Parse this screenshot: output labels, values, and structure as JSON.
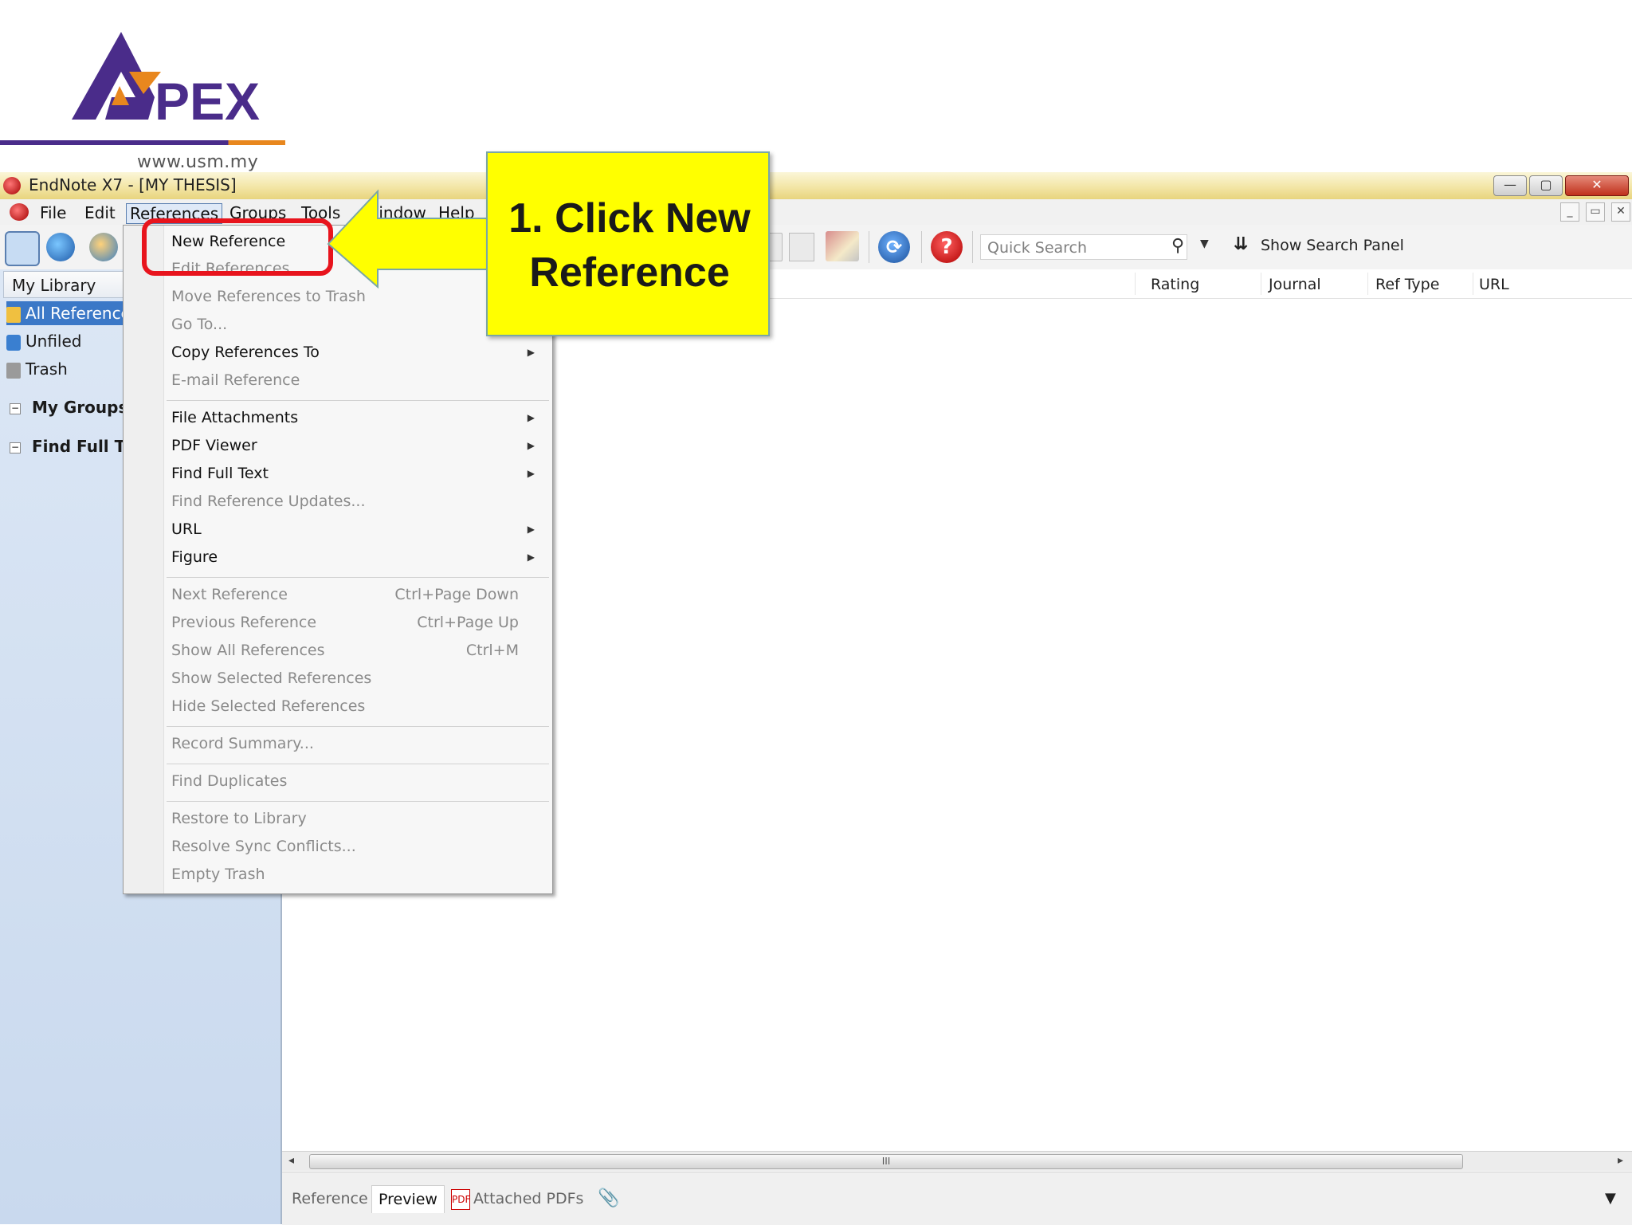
{
  "logo": {
    "brand": "APEX",
    "url": "www.usm.my"
  },
  "window": {
    "title": "EndNote X7 - [MY THESIS]",
    "buttons": {
      "minimize": "—",
      "maximize": "▢",
      "close": "✕"
    }
  },
  "menubar": {
    "items": [
      "File",
      "Edit",
      "References",
      "Groups",
      "Tools",
      "Window",
      "Help"
    ],
    "mdi_buttons": [
      "_",
      "▭",
      "✕"
    ]
  },
  "toolbar": {
    "quick_search_placeholder": "Quick Search",
    "show_search_panel": "Show Search Panel"
  },
  "left_panel": {
    "header": "My Library",
    "items": [
      "All References",
      "Unfiled",
      "Trash"
    ],
    "groups": [
      "My Groups",
      "Find Full Text"
    ]
  },
  "columns": [
    "Rating",
    "Journal",
    "Ref Type",
    "URL"
  ],
  "references_menu": {
    "items": [
      {
        "label": "New Reference",
        "enabled": true,
        "shortcut": ""
      },
      {
        "label": "Edit References",
        "enabled": false,
        "shortcut": ""
      },
      {
        "label": "Move References to Trash",
        "enabled": false,
        "shortcut": ""
      },
      {
        "label": "Go To...",
        "enabled": false,
        "shortcut": ""
      },
      {
        "label": "Copy References To",
        "enabled": true,
        "submenu": true
      },
      {
        "label": "E-mail Reference",
        "enabled": false
      },
      {
        "label": "File Attachments",
        "enabled": true,
        "submenu": true
      },
      {
        "label": "PDF Viewer",
        "enabled": true,
        "submenu": true
      },
      {
        "label": "Find Full Text",
        "enabled": true,
        "submenu": true
      },
      {
        "label": "Find Reference Updates...",
        "enabled": false
      },
      {
        "label": "URL",
        "enabled": true,
        "submenu": true
      },
      {
        "label": "Figure",
        "enabled": true,
        "submenu": true
      },
      {
        "label": "Next Reference",
        "enabled": false,
        "shortcut": "Ctrl+Page Down"
      },
      {
        "label": "Previous Reference",
        "enabled": false,
        "shortcut": "Ctrl+Page Up"
      },
      {
        "label": "Show All References",
        "enabled": false,
        "shortcut": "Ctrl+M"
      },
      {
        "label": "Show Selected References",
        "enabled": false
      },
      {
        "label": "Hide Selected References",
        "enabled": false
      },
      {
        "label": "Record Summary...",
        "enabled": false
      },
      {
        "label": "Find Duplicates",
        "enabled": false
      },
      {
        "label": "Restore to Library",
        "enabled": false
      },
      {
        "label": "Resolve Sync Conflicts...",
        "enabled": false
      },
      {
        "label": "Empty Trash",
        "enabled": false
      }
    ]
  },
  "bottom_tabs": [
    "Reference",
    "Preview",
    "Attached PDFs"
  ],
  "scrollbar": {
    "thumb_label": "III"
  },
  "callout": {
    "text": "1. Click New Reference",
    "color": "#ffff00",
    "highlight_color": "#e8141d"
  }
}
